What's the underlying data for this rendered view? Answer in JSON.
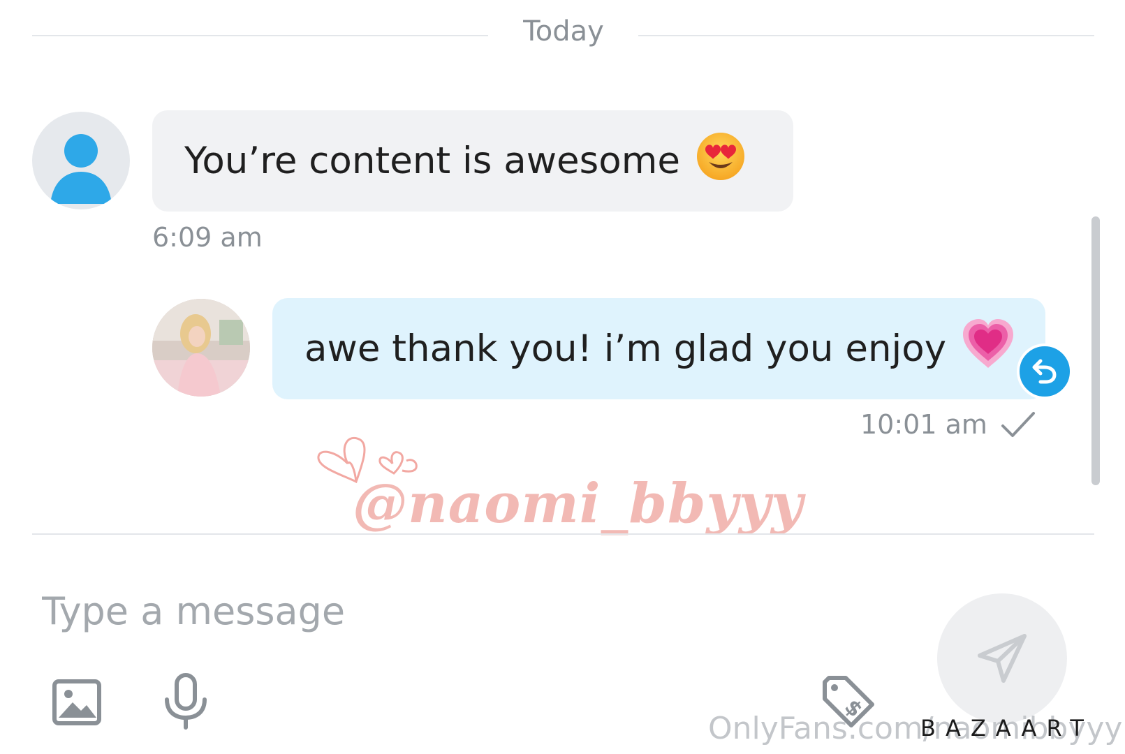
{
  "thread": {
    "date_divider": "Today",
    "messages": [
      {
        "direction": "incoming",
        "text": "You’re content is awesome",
        "emoji": "smiling-face-with-heart-eyes",
        "time": "6:09 am"
      },
      {
        "direction": "outgoing",
        "text": "awe thank you! i’m glad you enjoy",
        "emoji": "growing-heart",
        "time": "10:01 am",
        "status": "sent-check"
      }
    ]
  },
  "watermark": {
    "handle": "@naomi_bbyyy",
    "footer": "OnlyFans.com/naomibbyyy",
    "app_mark": "BAZAART"
  },
  "composer": {
    "placeholder": "Type a message",
    "value": ""
  },
  "colors": {
    "incoming_bubble": "#f1f2f4",
    "outgoing_bubble": "#dff3fd",
    "accent": "#1da1e6",
    "muted_text": "#8a9096",
    "watermark_pink": "#f2b9b4"
  }
}
